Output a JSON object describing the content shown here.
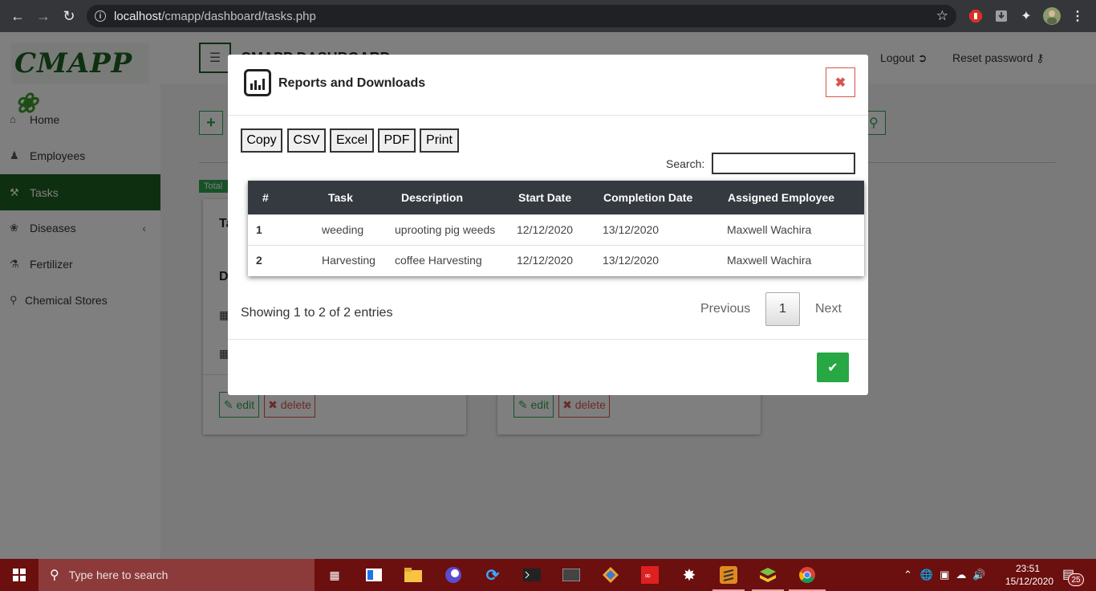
{
  "browser": {
    "url_host": "localhost",
    "url_path": "/cmapp/dashboard/tasks.php"
  },
  "app": {
    "logo_text": "CMAPP",
    "dashboard_title": "CMAPP DASHBOARD",
    "logout_label": "Logout",
    "reset_password_label": "Reset password",
    "total_badge": "Total"
  },
  "sidebar": {
    "items": [
      {
        "label": "Home",
        "icon": "home-icon"
      },
      {
        "label": "Employees",
        "icon": "user-icon"
      },
      {
        "label": "Tasks",
        "icon": "wrench-icon",
        "active": true
      },
      {
        "label": "Diseases",
        "icon": "leaf-icon"
      },
      {
        "label": "Fertilizer",
        "icon": "flask-icon"
      },
      {
        "label": "Chemical Stores",
        "icon": "map-marker-icon"
      }
    ]
  },
  "cards": {
    "card1_heading_partial": "Ta",
    "card1_sub_partial": "D",
    "edit_label": "edit",
    "delete_label": "delete"
  },
  "modal": {
    "title": "Reports and Downloads",
    "buttons": [
      "Copy",
      "CSV",
      "Excel",
      "PDF",
      "Print"
    ],
    "search_label": "Search:",
    "search_value": "",
    "table": {
      "headers": [
        "#",
        "Task",
        "Description",
        "Start Date",
        "Completion Date",
        "Assigned Employee"
      ],
      "rows": [
        [
          "1",
          "weeding",
          "uprooting pig weeds",
          "12/12/2020",
          "13/12/2020",
          "Maxwell Wachira"
        ],
        [
          "2",
          "Harvesting",
          "coffee Harvesting",
          "12/12/2020",
          "13/12/2020",
          "Maxwell Wachira"
        ]
      ]
    },
    "info": "Showing 1 to 2 of 2 entries",
    "pagination": {
      "previous": "Previous",
      "page": "1",
      "next": "Next"
    }
  },
  "taskbar": {
    "search_placeholder": "Type here to search",
    "time": "23:51",
    "date": "15/12/2020",
    "notification_count": "25"
  },
  "colors": {
    "brand_green": "#1d5e20",
    "accent_green": "#28a745",
    "danger": "#d9534f",
    "table_header": "#343a40",
    "taskbar": "#6b0f0f"
  }
}
